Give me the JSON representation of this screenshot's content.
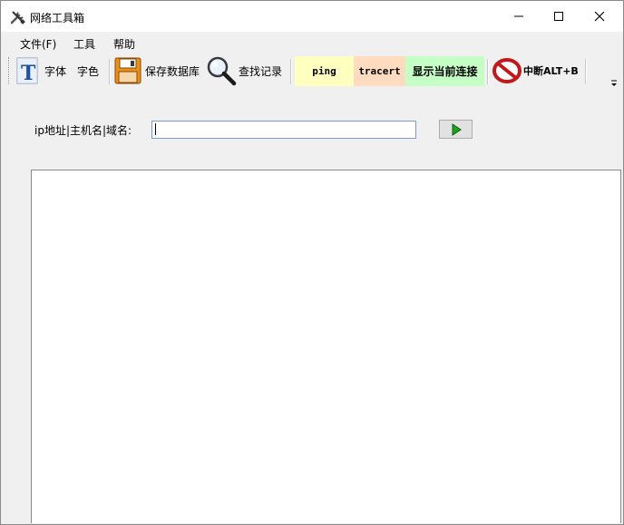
{
  "window": {
    "title": "网络工具箱",
    "app_icon": "tools-icon"
  },
  "menu": {
    "items": [
      {
        "label": "文件(F)"
      },
      {
        "label": "工具"
      },
      {
        "label": "帮助"
      }
    ]
  },
  "toolbar": {
    "font_label": "字体",
    "color_label": "字色",
    "save_db_label": "保存数据库",
    "find_label": "查找记录",
    "ping_label": "ping",
    "tracert_label": "tracert",
    "show_conn_label": "显示当前连接",
    "interrupt_label": "中断ALT+B",
    "colors": {
      "ping_bg": "#ffffc0",
      "tracert_bg": "#ffdcc0",
      "show_conn_bg": "#c6ffc6"
    }
  },
  "query": {
    "label": "ip地址|主机名|域名:",
    "value": "",
    "go_icon": "play-icon"
  },
  "output": {
    "text": ""
  }
}
